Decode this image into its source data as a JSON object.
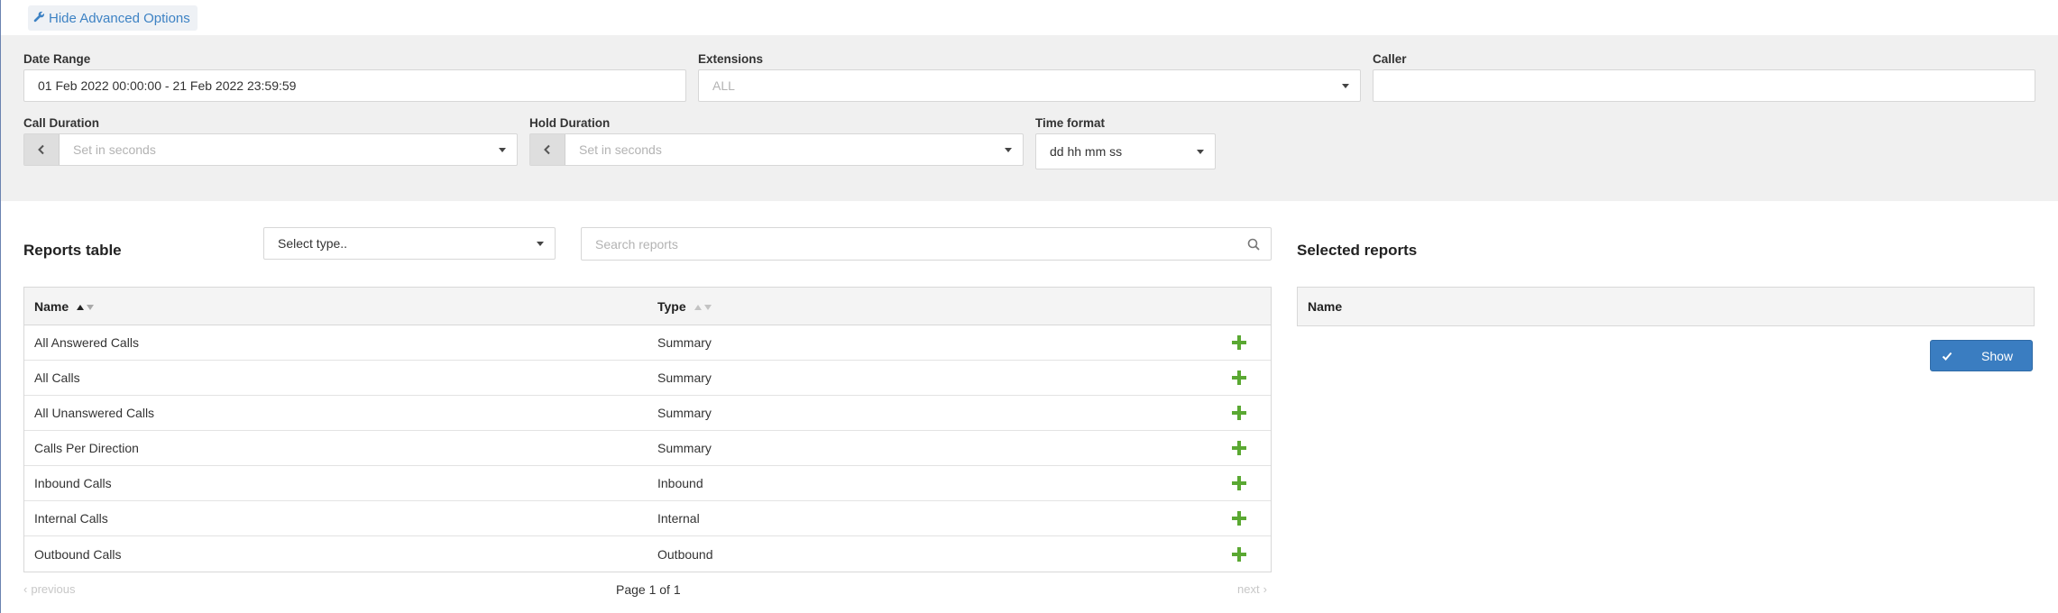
{
  "toggle": {
    "label": "Hide Advanced Options"
  },
  "filters": {
    "date_range": {
      "label": "Date Range",
      "value": "01 Feb 2022 00:00:00 - 21 Feb 2022 23:59:59"
    },
    "extensions": {
      "label": "Extensions",
      "value": "ALL"
    },
    "caller": {
      "label": "Caller",
      "value": ""
    },
    "call_duration": {
      "label": "Call Duration",
      "placeholder": "Set in seconds"
    },
    "hold_duration": {
      "label": "Hold Duration",
      "placeholder": "Set in seconds"
    },
    "time_format": {
      "label": "Time format",
      "value": "dd hh mm ss"
    }
  },
  "reports": {
    "title": "Reports table",
    "type_select": "Select type..",
    "search_placeholder": "Search reports",
    "columns": {
      "name": "Name",
      "type": "Type"
    },
    "rows": [
      {
        "name": "All Answered Calls",
        "type": "Summary"
      },
      {
        "name": "All Calls",
        "type": "Summary"
      },
      {
        "name": "All Unanswered Calls",
        "type": "Summary"
      },
      {
        "name": "Calls Per Direction",
        "type": "Summary"
      },
      {
        "name": "Inbound Calls",
        "type": "Inbound"
      },
      {
        "name": "Internal Calls",
        "type": "Internal"
      },
      {
        "name": "Outbound Calls",
        "type": "Outbound"
      }
    ],
    "pager": {
      "previous": "previous",
      "page": "Page 1 of 1",
      "next": "next"
    }
  },
  "selected": {
    "title": "Selected reports",
    "column_name": "Name",
    "show_label": "Show"
  },
  "colors": {
    "accent": "#3a7dc1",
    "add": "#5aa832",
    "panel": "#f0f0f0"
  }
}
